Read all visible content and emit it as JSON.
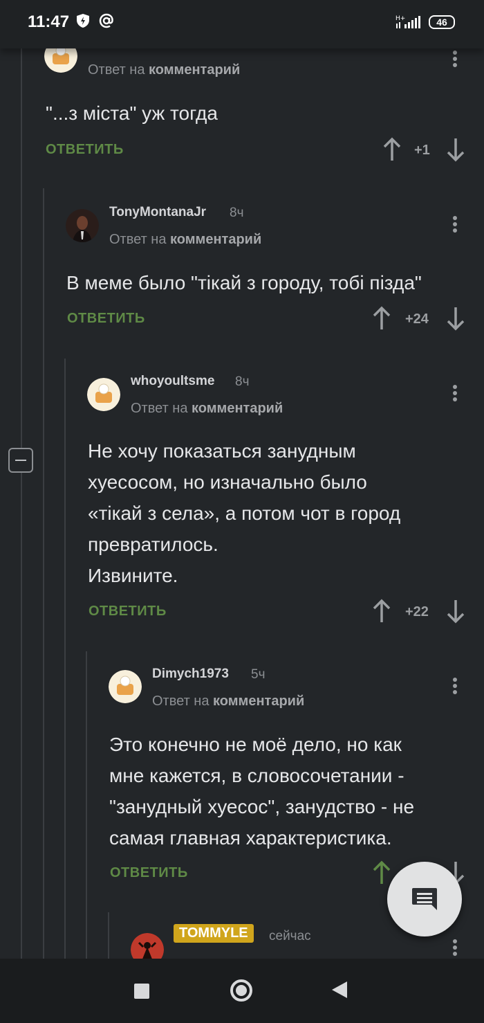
{
  "status_bar": {
    "time": "11:47",
    "battery": "46",
    "network": "H+"
  },
  "ui": {
    "reply_prefix": "Ответ на",
    "reply_target": "комментарий",
    "reply_button": "ОТВЕТИТЬ"
  },
  "comments": [
    {
      "username": "",
      "time": "",
      "body": "\"...з міста\" уж тогда",
      "score": "+1"
    },
    {
      "username": "TonyMontanaJr",
      "time": "8ч",
      "body": "В меме было \"тікай з городу, тобі пізда\"",
      "score": "+24"
    },
    {
      "username": "whoyoultsme",
      "time": "8ч",
      "body_lines": [
        "Не хочу показаться занудным",
        "хуесосом, но изначально было",
        "«тікай з села», а потом чот в город",
        "превратилось.",
        "Извините."
      ],
      "score": "+22"
    },
    {
      "username": "Dimych1973",
      "time": "5ч",
      "body_lines": [
        "Это конечно не моё дело, но как",
        "мне кажется, в словосочетании -",
        "\"занудный хуесос\", занудство - не",
        "самая главная характеристика."
      ],
      "score": ""
    },
    {
      "username": "TOMMYLE",
      "time": "сейчас"
    }
  ],
  "colors": {
    "background": "#232629",
    "reply_green": "#5f8a46",
    "badge_gold": "#d0a51c",
    "upvoted_arrow": "#5f8a46"
  }
}
